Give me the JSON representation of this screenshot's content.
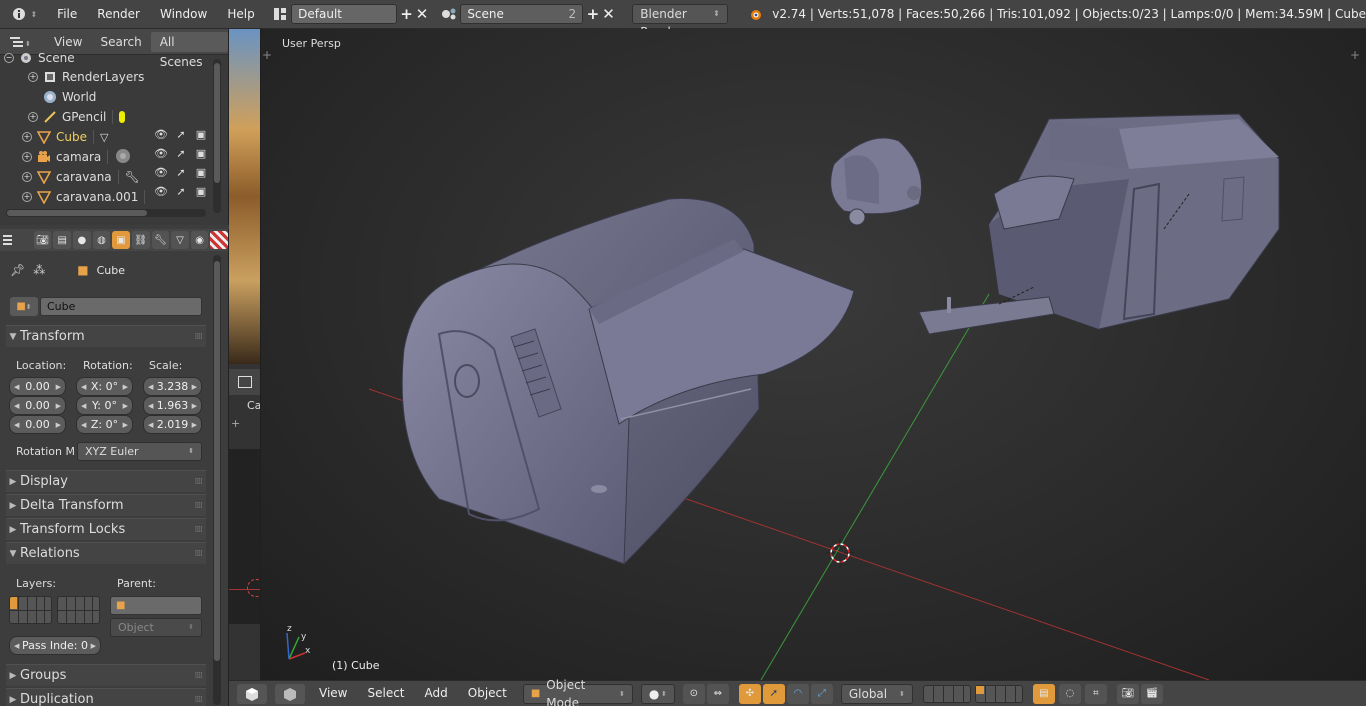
{
  "topbar": {
    "menus": [
      "File",
      "Render",
      "Window",
      "Help"
    ],
    "screen_layout": "Default",
    "scene_name": "Scene",
    "scene_users": "2",
    "render_engine": "Blender Render",
    "stats": "v2.74 | Verts:51,078 | Faces:50,266 | Tris:101,092 | Objects:0/23 | Lamps:0/0 | Mem:34.59M | Cube"
  },
  "outliner": {
    "tabs": [
      "View",
      "Search",
      "All Scenes"
    ],
    "items": [
      {
        "label": "Scene",
        "icon": "scene-icon"
      },
      {
        "label": "RenderLayers",
        "icon": "render-layers-icon"
      },
      {
        "label": "World",
        "icon": "world-icon"
      },
      {
        "label": "GPencil",
        "icon": "grease-pencil-icon"
      },
      {
        "label": "Cube",
        "icon": "mesh-icon"
      },
      {
        "label": "camara",
        "icon": "camera-icon"
      },
      {
        "label": "caravana",
        "icon": "mesh-icon"
      },
      {
        "label": "caravana.001",
        "icon": "mesh-icon"
      }
    ]
  },
  "properties": {
    "context_object": "Cube",
    "object_name": "Cube",
    "transform": {
      "title": "Transform",
      "location_label": "Location:",
      "rotation_label": "Rotation:",
      "scale_label": "Scale:",
      "location": [
        "0.00",
        "0.00",
        "0.00"
      ],
      "rotation": [
        "X: 0°",
        "Y: 0°",
        "Z: 0°"
      ],
      "scale": [
        "3.238",
        "1.963",
        "2.019"
      ],
      "rotation_mode_label": "Rotation M",
      "rotation_mode": "XYZ Euler"
    },
    "panels": {
      "display": "Display",
      "delta_transform": "Delta Transform",
      "transform_locks": "Transform Locks",
      "relations": "Relations",
      "groups": "Groups",
      "duplication": "Duplication"
    },
    "relations": {
      "layers_label": "Layers:",
      "parent_label": "Parent:",
      "parent_type": "Object",
      "pass_index": "Pass Inde:  0"
    }
  },
  "viewport": {
    "view_name": "User Persp",
    "active_object": "(1) Cube",
    "strip_label": "Ca"
  },
  "footer": {
    "menus": [
      "View",
      "Select",
      "Add",
      "Object"
    ],
    "mode": "Object Mode",
    "orientation": "Global"
  },
  "colors": {
    "accent": "#e09a3c",
    "x_axis": "#c23a3a",
    "y_axis": "#3ea33e",
    "mesh": "#6e6e86"
  }
}
